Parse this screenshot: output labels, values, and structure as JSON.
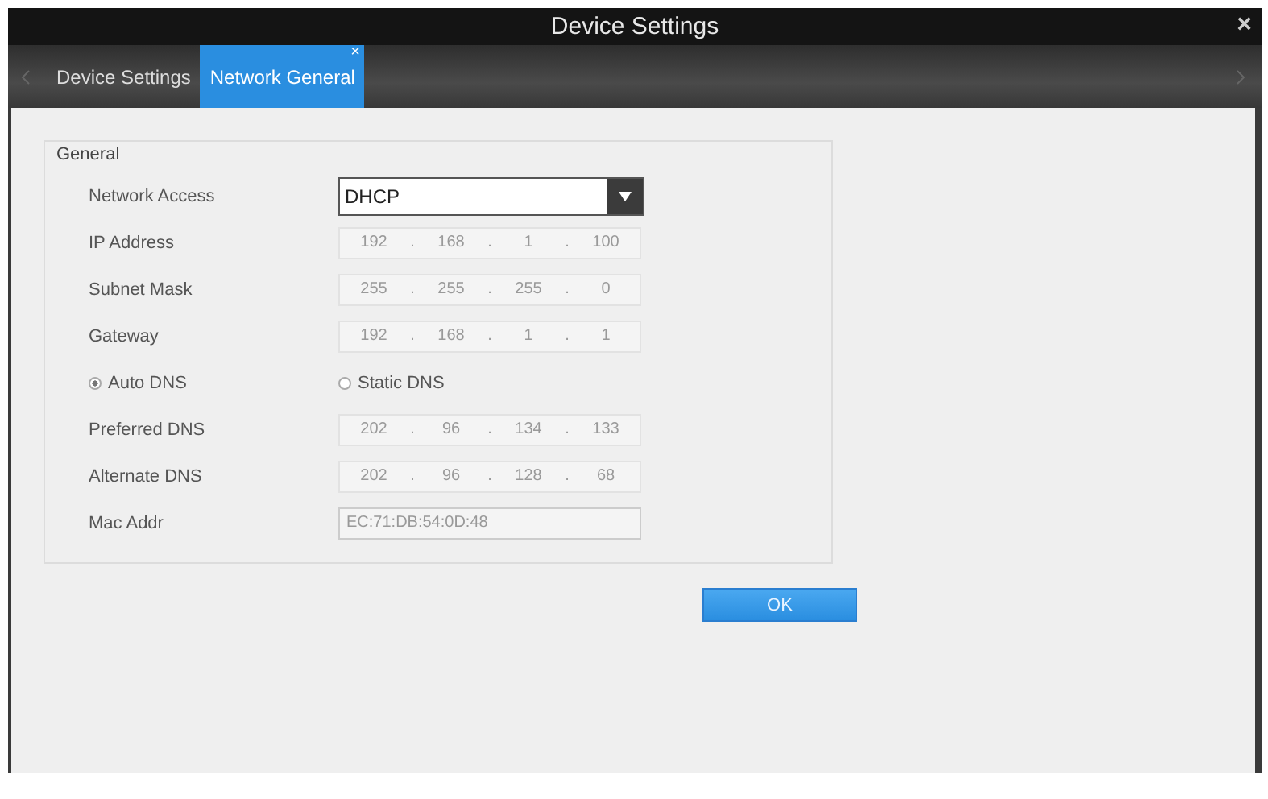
{
  "window": {
    "title": "Device Settings",
    "close": "×"
  },
  "tabs": [
    {
      "label": "Device Settings",
      "selected": false,
      "closable": false
    },
    {
      "label": "Network General",
      "selected": true,
      "closable": true
    }
  ],
  "tab_close": "×",
  "group": {
    "title": "General"
  },
  "rows": [
    {
      "kind": "select",
      "label": "Network Access",
      "value": "DHCP"
    },
    {
      "kind": "ip",
      "label": "IP Address",
      "octets": [
        "192",
        "168",
        "1",
        "100"
      ],
      "disabled": true
    },
    {
      "kind": "ip",
      "label": "Subnet Mask",
      "octets": [
        "255",
        "255",
        "255",
        "0"
      ],
      "disabled": true
    },
    {
      "kind": "ip",
      "label": "Gateway",
      "octets": [
        "192",
        "168",
        "1",
        "1"
      ],
      "disabled": true
    },
    {
      "kind": "radio",
      "options": [
        {
          "label": "Auto DNS",
          "selected": true
        },
        {
          "label": "Static DNS",
          "selected": false
        }
      ]
    },
    {
      "kind": "ip",
      "label": "Preferred DNS",
      "octets": [
        "202",
        "96",
        "134",
        "133"
      ],
      "disabled": true
    },
    {
      "kind": "ip",
      "label": "Alternate DNS",
      "octets": [
        "202",
        "96",
        "128",
        "68"
      ],
      "disabled": true
    },
    {
      "kind": "text",
      "label": "Mac Addr",
      "value": "EC:71:DB:54:0D:48",
      "disabled": true
    }
  ],
  "ip_separator": ".",
  "ok_button": "OK"
}
